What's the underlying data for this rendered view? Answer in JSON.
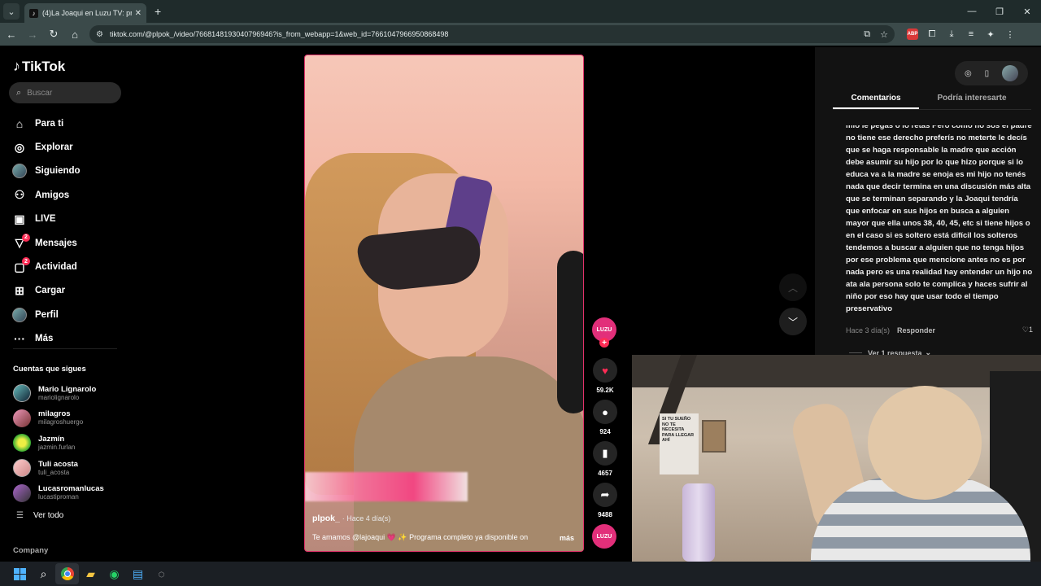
{
  "browser": {
    "tab_title": "(4)La Joaqui en Luzu TV: progra",
    "tab_favicon": "tiktok-icon",
    "url": "tiktok.com/@plpok_/video/7668148193040796946?is_from_webapp=1&web_id=7661047966950868498",
    "abp_label": "ABP"
  },
  "sidebar": {
    "logo_text": "TikTok",
    "search_placeholder": "Buscar",
    "nav": [
      {
        "label": "Para ti",
        "icon": "home-icon"
      },
      {
        "label": "Explorar",
        "icon": "compass-icon"
      },
      {
        "label": "Siguiendo",
        "icon": "avatar-icon"
      },
      {
        "label": "Amigos",
        "icon": "friends-icon"
      },
      {
        "label": "LIVE",
        "icon": "live-icon"
      },
      {
        "label": "Mensajes",
        "icon": "messages-icon",
        "badge": "2"
      },
      {
        "label": "Actividad",
        "icon": "activity-icon",
        "badge": "2"
      },
      {
        "label": "Cargar",
        "icon": "upload-icon"
      },
      {
        "label": "Perfil",
        "icon": "profile-icon"
      },
      {
        "label": "Más",
        "icon": "more-icon"
      }
    ],
    "following_title": "Cuentas que sigues",
    "following": [
      {
        "name": "Mario Lignarolo",
        "handle": "mariolignarolo"
      },
      {
        "name": "milagros",
        "handle": "milagroshuergo"
      },
      {
        "name": "Jazmín",
        "handle": "jazmin.furlan"
      },
      {
        "name": "Tuli acosta",
        "handle": "tuli_acosta"
      },
      {
        "name": "Lucasromanlucas",
        "handle": "lucastiproman"
      }
    ],
    "see_all": "Ver todo",
    "company": "Company"
  },
  "video": {
    "author": "plpok_",
    "date": "· Hace 4 día(s)",
    "caption": "Te amamos @lajoaqui 💗 ✨ Programa completo ya disponible on",
    "more": "más",
    "creator_badge": "LUZU"
  },
  "actions": {
    "likes": "59.2K",
    "comments": "924",
    "saves": "4657",
    "shares": "9488"
  },
  "comments": {
    "tab_active": "Comentarios",
    "tab_other": "Podría interesarte",
    "text": "mío le pegás o lo retás Pero como no sos el padre no tiene ese derecho preferís no meterte le decís que se haga responsable la madre que acción debe asumir su hijo por lo que hizo porque si lo educa va a la madre se enoja es mi hijo no tenés nada que decir termina en una discusión más alta que se terminan separando y la Joaqui tendría que enfocar en sus hijos en busca a alguien mayor que ella unos 38, 40, 45, etc si tiene hijos o en el caso si es soltero está difícil los solteros tendemos a buscar a alguien que no tenga hijos por ese problema que mencione antes no es por nada pero es una realidad hay entender un hijo no ata ala persona solo te complica y haces sufrir al niño por eso hay que usar todo el tiempo preservativo",
    "ago": "Hace 3 día(s)",
    "reply": "Responder",
    "likes": "1",
    "view_replies": "Ver 1 respuesta"
  },
  "webcam": {
    "poster_text": "SI TU SUEÑO NO TE NECESITA PARA LLEGAR AHÍ"
  },
  "colors": {
    "accent": "#fe2c55",
    "video_border": "#e2326b"
  }
}
